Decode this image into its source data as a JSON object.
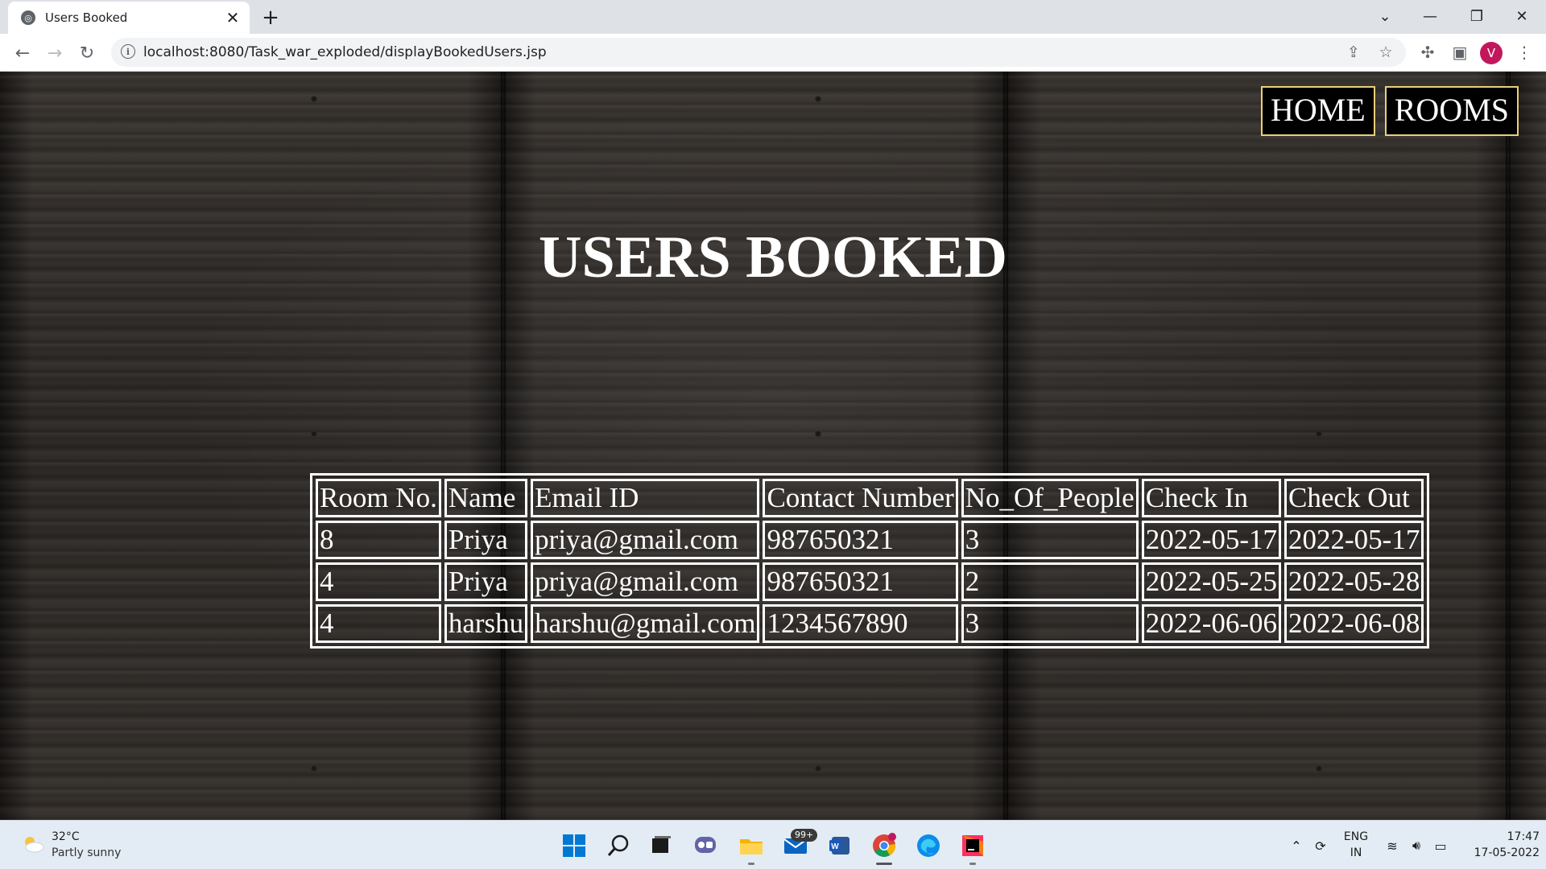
{
  "browser": {
    "tab_title": "Users Booked",
    "url": "localhost:8080/Task_war_exploded/displayBookedUsers.jsp",
    "profile_initial": "V"
  },
  "nav": {
    "home_label": "HOME",
    "rooms_label": "ROOMS"
  },
  "page": {
    "heading": "USERS BOOKED"
  },
  "bookings": {
    "columns": [
      "Room No.",
      "Name",
      "Email ID",
      "Contact Number",
      "No_Of_People",
      "Check In",
      "Check Out"
    ],
    "rows": [
      [
        "8",
        "Priya",
        "priya@gmail.com",
        "987650321",
        "3",
        "2022-05-17",
        "2022-05-17"
      ],
      [
        "4",
        "Priya",
        "priya@gmail.com",
        "987650321",
        "2",
        "2022-05-25",
        "2022-05-28"
      ],
      [
        "4",
        "harshu",
        "harshu@gmail.com",
        "1234567890",
        "3",
        "2022-06-06",
        "2022-06-08"
      ]
    ]
  },
  "taskbar": {
    "weather_temp": "32°C",
    "weather_desc": "Partly sunny",
    "mail_badge": "99+",
    "lang_line1": "ENG",
    "lang_line2": "IN",
    "time": "17:47",
    "date": "17-05-2022"
  },
  "colors": {
    "nav_border": "#e8cf7a",
    "profile_avatar": "#c2185b"
  }
}
